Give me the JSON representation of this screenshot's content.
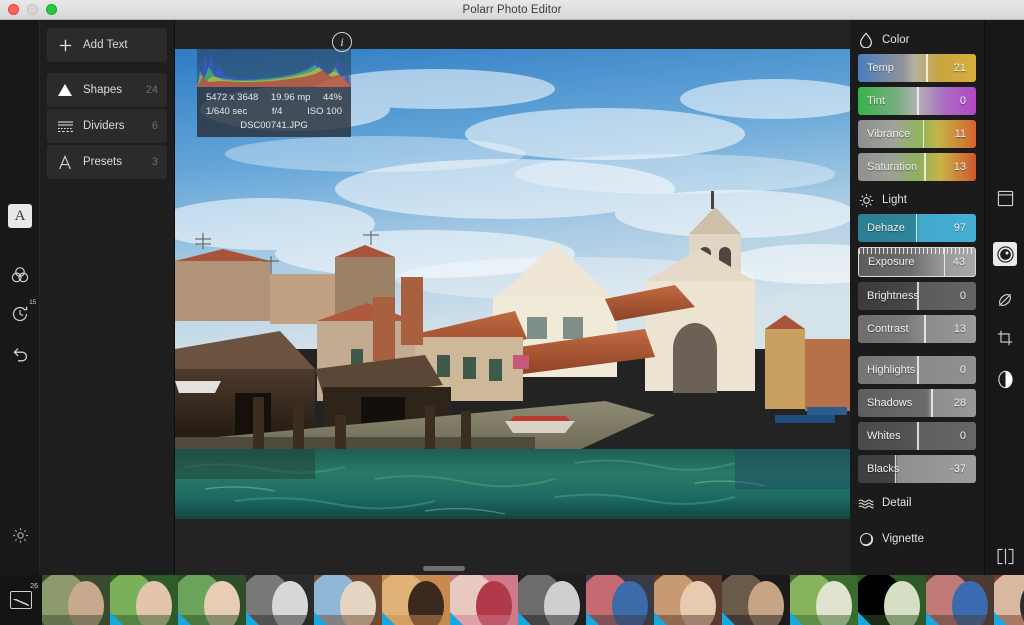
{
  "window": {
    "title": "Polarr Photo Editor",
    "controls": [
      {
        "name": "close",
        "color": "#ff5f57"
      },
      {
        "name": "minimize",
        "color": "#d6d6d6"
      },
      {
        "name": "maximize",
        "color": "#28c940"
      }
    ]
  },
  "left_rail": {
    "items": [
      {
        "name": "text-tool",
        "icon": "letter-a-icon",
        "label": "A",
        "active": true
      },
      {
        "name": "color-tool",
        "icon": "color-circles-icon",
        "active": false
      },
      {
        "name": "history-tool",
        "icon": "history-clock-icon",
        "badge": "15",
        "active": false
      },
      {
        "name": "undo-tool",
        "icon": "undo-arrow-icon",
        "active": false
      },
      {
        "name": "settings",
        "icon": "gear-icon",
        "active": false
      }
    ]
  },
  "left_panel": {
    "items": [
      {
        "icon": "plus-icon",
        "label": "Add Text",
        "count": ""
      },
      {
        "icon": "triangle-icon",
        "label": "Shapes",
        "count": "24"
      },
      {
        "icon": "dividers-icon",
        "label": "Dividers",
        "count": "6"
      },
      {
        "icon": "letter-a-icon",
        "label": "Presets",
        "count": "3"
      }
    ]
  },
  "canvas": {
    "info_button": "i",
    "metadata": {
      "dimensions": "5472 x 3648",
      "megapixels": "19.96 mp",
      "zoom": "44%",
      "shutter": "1/640 sec",
      "aperture": "f/4",
      "iso": "ISO 100",
      "filename": "DSC00741.JPG"
    }
  },
  "right_panel": {
    "sections": [
      {
        "id": "color",
        "icon": "droplet-icon",
        "title": "Color",
        "sliders": [
          {
            "name": "Temp",
            "value": "21",
            "pos": 58,
            "gradient": "linear-gradient(to right,#4a7fc0 0%,#8f9298 38%,#b6b0a0 48%,#c9a542 68%,#d6ae3b 100%)"
          },
          {
            "name": "Tint",
            "value": "0",
            "pos": 50,
            "gradient": "linear-gradient(to right,#36b24a 0%,#7fae86 36%,#b3b3b3 50%,#a86fc0 72%,#b446c6 100%)"
          },
          {
            "name": "Vibrance",
            "value": "11",
            "pos": 55,
            "gradient": "linear-gradient(to right,#8e8e8e 0%,#a0a39a 30%,#8fb55e 52%,#c5b348 68%,#d4632f 100%)"
          },
          {
            "name": "Saturation",
            "value": "13",
            "pos": 56,
            "gradient": "linear-gradient(to right,#909090 0%,#9ba197 28%,#8fb05f 50%,#c9b245 70%,#d0572e 100%)"
          }
        ]
      },
      {
        "id": "light",
        "icon": "sun-icon",
        "title": "Light",
        "sliders": [
          {
            "name": "Dehaze",
            "value": "97",
            "pos": 49,
            "gradient": "linear-gradient(to right,#2b7e93 0%,#2f8599 48%,#42a9cc 52%,#46b0d4 100%)"
          },
          {
            "name": "Exposure",
            "value": "43",
            "pos": 73,
            "active": true,
            "ruler": true,
            "gradient": "linear-gradient(to right,#5d5d5d 0%,#6e6e6e 45%,#9a9a9a 73%,#a9a9a9 100%)"
          },
          {
            "name": "Brightness",
            "value": "0",
            "pos": 50,
            "gradient": "linear-gradient(to right,#3b3b3b 0%,#484848 48%,#5a5a5a 52%,#656565 100%)"
          },
          {
            "name": "Contrast",
            "value": "13",
            "pos": 56,
            "gradient": "linear-gradient(to right,#6d6d6d 0%,#797979 40%,#8b8b8b 56%,#9a9a9a 100%)"
          },
          {
            "name": "Highlights",
            "value": "0",
            "pos": 50,
            "gradient": "linear-gradient(to right,#757575 0%,#7d7d7d 48%,#8a8a8a 52%,#909090 100%)"
          },
          {
            "name": "Shadows",
            "value": "28",
            "pos": 62,
            "gradient": "linear-gradient(to right,#5e5e5e 0%,#6a6a6a 58%,#8d8d8d 62%,#999999 100%)"
          },
          {
            "name": "Whites",
            "value": "0",
            "pos": 50,
            "gradient": "linear-gradient(to right,#4a4a4a 0%,#545454 48%,#5f5f5f 52%,#666666 100%)"
          },
          {
            "name": "Blacks",
            "value": "-37",
            "pos": 31,
            "gradient": "linear-gradient(to right,#3e3e3e 0%,#424242 30%,#8f8f8f 34%,#9d9d9d 100%)"
          }
        ]
      },
      {
        "id": "detail",
        "icon": "waves-icon",
        "title": "Detail",
        "sliders": []
      },
      {
        "id": "vignette",
        "icon": "circle-icon",
        "title": "Vignette",
        "sliders": []
      }
    ]
  },
  "right_rail": {
    "items": [
      {
        "name": "frame-tool",
        "icon": "frame-icon",
        "active": false
      },
      {
        "name": "adjust-tool",
        "icon": "adjust-knob-icon",
        "active": true
      },
      {
        "name": "retouch-tool",
        "icon": "brush-slash-icon",
        "active": false
      },
      {
        "name": "crop-tool",
        "icon": "crop-icon",
        "active": false
      },
      {
        "name": "mask-tool",
        "icon": "half-circle-icon",
        "active": false
      },
      {
        "name": "compare-tool",
        "icon": "split-compare-icon",
        "active": false
      }
    ]
  },
  "filmstrip": {
    "photo_count_badge": "26",
    "photo_icon": "photo-library-icon",
    "thumbnails": [
      {
        "id": 1,
        "selected": false,
        "marker": false,
        "palette": [
          "#3a4a2e",
          "#8d9a6c",
          "#c9a98e"
        ]
      },
      {
        "id": 2,
        "selected": false,
        "marker": true,
        "palette": [
          "#2f5a2a",
          "#7bb05a",
          "#e3c4ad"
        ]
      },
      {
        "id": 3,
        "selected": false,
        "marker": true,
        "palette": [
          "#2c4f2a",
          "#6ba35a",
          "#e8cdb4"
        ]
      },
      {
        "id": 4,
        "selected": false,
        "marker": true,
        "palette": [
          "#2a2a2a",
          "#787878",
          "#d8d8d8"
        ]
      },
      {
        "id": 5,
        "selected": false,
        "marker": true,
        "palette": [
          "#6e4a33",
          "#8fb8d8",
          "#e4d6c2"
        ]
      },
      {
        "id": 6,
        "selected": false,
        "marker": true,
        "palette": [
          "#c98a50",
          "#e0b277",
          "#3a2a1e"
        ]
      },
      {
        "id": 7,
        "selected": false,
        "marker": true,
        "palette": [
          "#d07a8c",
          "#e8c9c0",
          "#b03a4a"
        ]
      },
      {
        "id": 8,
        "selected": false,
        "marker": true,
        "palette": [
          "#1e1e1e",
          "#6c6c6c",
          "#cfcfcf"
        ]
      },
      {
        "id": 9,
        "selected": false,
        "marker": true,
        "palette": [
          "#3a3a44",
          "#c46a70",
          "#3b6ba8"
        ]
      },
      {
        "id": 10,
        "selected": false,
        "marker": true,
        "palette": [
          "#5a3a2c",
          "#c79a74",
          "#e7cbb0"
        ]
      },
      {
        "id": 11,
        "selected": false,
        "marker": true,
        "palette": [
          "#1b1b1b",
          "#6a5a4a",
          "#c7a484"
        ]
      },
      {
        "id": 12,
        "selected": false,
        "marker": true,
        "palette": [
          "#3b6a2e",
          "#86b35c",
          "#dfe3cf"
        ]
      },
      {
        "id": 13,
        "selected": false,
        "marker": true,
        "palette": [
          "#2f5a28",
          "#7aa martial",
          "#d6dec4"
        ]
      },
      {
        "id": 14,
        "selected": false,
        "marker": true,
        "palette": [
          "#4a3a32",
          "#c07a78",
          "#3a6ab0"
        ]
      },
      {
        "id": 15,
        "selected": false,
        "marker": true,
        "palette": [
          "#7a3a30",
          "#d8b8a0",
          "#2b2b2b"
        ]
      },
      {
        "id": 16,
        "selected": true,
        "marker": false,
        "palette": [
          "#4a7fc0",
          "#b5713f",
          "#2e6a52"
        ]
      },
      {
        "id": 17,
        "selected": false,
        "marker": false,
        "palette": [
          "#6f8fb8",
          "#cbb9a2",
          "#3b4a58"
        ]
      }
    ]
  }
}
